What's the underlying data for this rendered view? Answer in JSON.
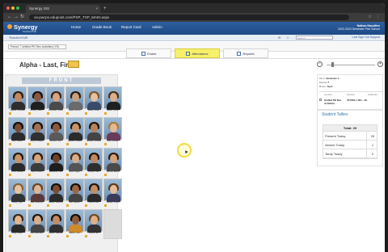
{
  "browser": {
    "tab_title": "Synergy SIS",
    "url": "va-pwcps.edupoint.com/PXP_TXP_MAIN.aspx"
  },
  "app": {
    "logo": "Synergy",
    "logo_sub": "TeacherVUE",
    "menu": [
      "Home",
      "Grade Book",
      "Report Card",
      "Admin"
    ],
    "user_name": "Nathan Nacuitive",
    "user_sub": "2022-2023 Semester Five School",
    "brand_short": "TeacherVUE",
    "search_placeholder": "Search",
    "links": "Last  Sign Out  Support"
  },
  "class_selector": "Period 7 Unified PE Rec Activities (Y9)",
  "tabs": [
    {
      "label": "Charts",
      "active": false
    },
    {
      "label": "Attendance",
      "active": true
    },
    {
      "label": "Reports",
      "active": false
    }
  ],
  "page_title": "Alpha - Last, First",
  "front_label": "FRONT",
  "students": [
    {
      "name": "Aguilar, Michael",
      "skin": "#c08a5e",
      "hair": "#2a1c10",
      "shirt": "#2d2d2d"
    },
    {
      "name": "Aldred, Jalen",
      "skin": "#8b5a3c",
      "hair": "#1a110a",
      "shirt": "#1f1f1f"
    },
    {
      "name": "Andrade, Sofia",
      "skin": "#d9a57f",
      "hair": "#3b2414",
      "shirt": "#4a4a4a"
    },
    {
      "name": "Ayala, Alexis",
      "skin": "#caa07c",
      "hair": "#2a1b10",
      "shirt": "#6b6b6b"
    },
    {
      "name": "Baker, Evan",
      "skin": "#e6c1a0",
      "hair": "#7a5530",
      "shirt": "#3a4a6a"
    },
    {
      "name": "Bauer, Dylan",
      "skin": "#dcb08c",
      "hair": "#4a2e18",
      "shirt": "#1f1f1f"
    },
    {
      "name": "Bell, Jaden",
      "skin": "#7a4b30",
      "hair": "#120c08",
      "shirt": "#2b2b2b"
    },
    {
      "name": "Boyd, Amaya",
      "skin": "#a4714c",
      "hair": "#1a120a",
      "shirt": "#303030"
    },
    {
      "name": "Brooks, Nia",
      "skin": "#8a5a3a",
      "hair": "#1a110a",
      "shirt": "#5a5a5a"
    },
    {
      "name": "Castillo, Mateo",
      "skin": "#c8946a",
      "hair": "#221508",
      "shirt": "#2b2b2b"
    },
    {
      "name": "Chavez, Jordan",
      "skin": "#b98258",
      "hair": "#20140a",
      "shirt": "#444"
    },
    {
      "name": "Cole, Ashley",
      "skin": "#e2b994",
      "hair": "#a87c3c",
      "shirt": "#6a3a5a"
    },
    {
      "name": "Cruz, Daniel",
      "skin": "#c79468",
      "hair": "#231608",
      "shirt": "#2a2a2a"
    },
    {
      "name": "Diaz, Lucia",
      "skin": "#d8a47a",
      "hair": "#2c1a0c",
      "shirt": "#3b3b3b"
    },
    {
      "name": "Edwards, Kai",
      "skin": "#6e432a",
      "hair": "#110b06",
      "shirt": "#1d1d1d"
    },
    {
      "name": "Ellis, Maya",
      "skin": "#d9ad88",
      "hair": "#4a2c16",
      "shirt": "#555"
    },
    {
      "name": "Flores, Ivan",
      "skin": "#c0895e",
      "hair": "#1e1208",
      "shirt": "#2e2e2e"
    },
    {
      "name": "Garcia, Elena",
      "skin": "#d6a27a",
      "hair": "#2d1a0c",
      "shirt": "#4a4a4a"
    },
    {
      "name": "Gray, Tyler",
      "skin": "#e8c3a2",
      "hair": "#8a6236",
      "shirt": "#333"
    },
    {
      "name": "Hall, Brianna",
      "skin": "#e0b693",
      "hair": "#6a4424",
      "shirt": "#5a3a3a"
    },
    {
      "name": "Hayes, Marcus",
      "skin": "#7d4d31",
      "hair": "#130d07",
      "shirt": "#2b2b2b"
    },
    {
      "name": "Hill, Naomi",
      "skin": "#9a6644",
      "hair": "#160f08",
      "shirt": "#444"
    },
    {
      "name": "Ibarra, Leo",
      "skin": "#c48e62",
      "hair": "#21150a",
      "shirt": "#2a2a2a"
    },
    {
      "name": "James, Chloe",
      "skin": "#e4bd9a",
      "hair": "#5a3a1c",
      "shirt": "#3a3a5a"
    },
    {
      "name": "King, Aiden",
      "skin": "#e0b58f",
      "hair": "#3a2412",
      "shirt": "#2a2a2a"
    },
    {
      "name": "Lee, Hannah",
      "skin": "#d9ad85",
      "hair": "#1e140a",
      "shirt": "#444"
    },
    {
      "name": "Lopez, Gabriel",
      "skin": "#c38c60",
      "hair": "#20140a",
      "shirt": "#303030"
    },
    {
      "name": "Martin, Zoe",
      "skin": "#8e5c3b",
      "hair": "#130c06",
      "shirt": "#d08a2a"
    },
    {
      "name": "Moore, Eli",
      "skin": "#deb18b",
      "hair": "#6e4a28",
      "shirt": "#333"
    }
  ],
  "info_panel": {
    "term_label": "Term:",
    "term": "Semester 1",
    "period_label": "Period:",
    "period": "7",
    "room_label": "Room:",
    "room": "Gym",
    "col_course": "Course",
    "col_section": "Section",
    "col_students": "Students",
    "course": "Unified PE Rec Activities",
    "section": "7070Z0-7-001 - 29",
    "students": ""
  },
  "tallies": {
    "heading": "Student Tallies",
    "total_label": "Total: 29",
    "rows": [
      {
        "label": "Present Today",
        "value": "29"
      },
      {
        "label": "Absent Today",
        "value": "1"
      },
      {
        "label": "Tardy Today",
        "value": "0"
      }
    ]
  },
  "colors": {
    "header_blue": "#1d4a86",
    "active_tab": "#f7f06b",
    "front_bar": "#bdc9d7",
    "tally_heading": "#3575b5"
  }
}
